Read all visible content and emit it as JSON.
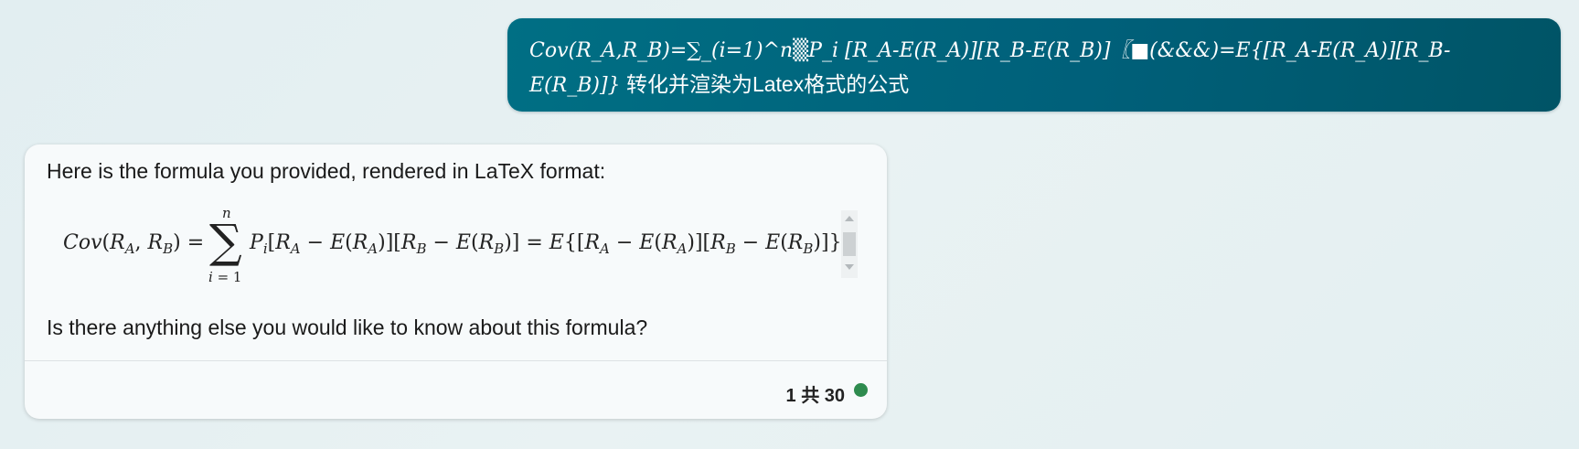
{
  "user_message": {
    "formula_text": "Cov(R_A,R_B)=∑_(i=1)^n▒P_i [R_A-E(R_A)][R_B-E(R_B)]〖■(&&&)=E{[R_A-E(R_A)][R_B-E(R_B)]}",
    "instruction_text": "转化并渲染为Latex格式的公式"
  },
  "assistant": {
    "intro_text": "Here is the formula you provided, rendered in LaTeX format:",
    "formula": {
      "lhs": "Cov(RA,RB) =",
      "sum_upper": "n",
      "sum_symbol": "∑",
      "sum_lower": "i = 1",
      "rhs": "Pi[RA − E(RA)][RB − E(RB)] = E{[RA − E(RA)][RB − E(RB)]}"
    },
    "outro_text": "Is there anything else you would like to know about this formula?",
    "footer": {
      "page_indicator": "1 共 30",
      "status_color": "#2e8b4e"
    }
  },
  "colors": {
    "user_bubble": "#00637a",
    "background": "#e6f0f2",
    "card": "#f7fafb"
  }
}
